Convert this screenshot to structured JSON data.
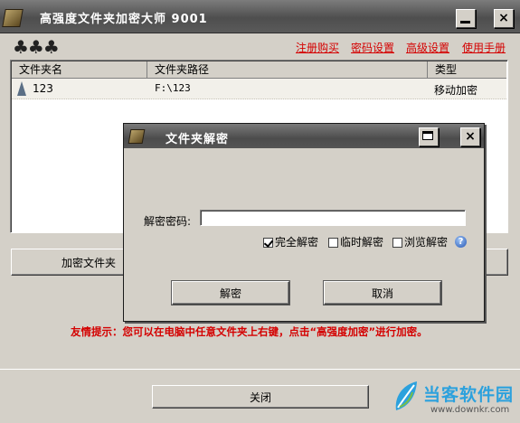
{
  "main_window": {
    "title": "高强度文件夹加密大师 9001",
    "logo_marks": "♣♣♣",
    "links": [
      "注册购买",
      "密码设置",
      "高级设置",
      "使用手册"
    ],
    "columns": [
      "文件夹名",
      "文件夹路径",
      "类型"
    ],
    "rows": [
      {
        "name": "123",
        "path": "F:\\123",
        "type": "移动加密"
      }
    ],
    "encrypt_button": "加密文件夹",
    "tip": "友情提示：您可以在电脑中任意文件夹上右键，点击“高强度加密”进行加密。",
    "close_button": "关闭"
  },
  "dialog": {
    "title": "文件夹解密",
    "password_label": "解密密码:",
    "password_value": "",
    "options": [
      {
        "label": "完全解密",
        "checked": true
      },
      {
        "label": "临时解密",
        "checked": false
      },
      {
        "label": "浏览解密",
        "checked": false
      }
    ],
    "help_glyph": "?",
    "decrypt_button": "解密",
    "cancel_button": "取消"
  },
  "watermark": {
    "text": "当客软件园",
    "url": "www.downkr.com"
  }
}
